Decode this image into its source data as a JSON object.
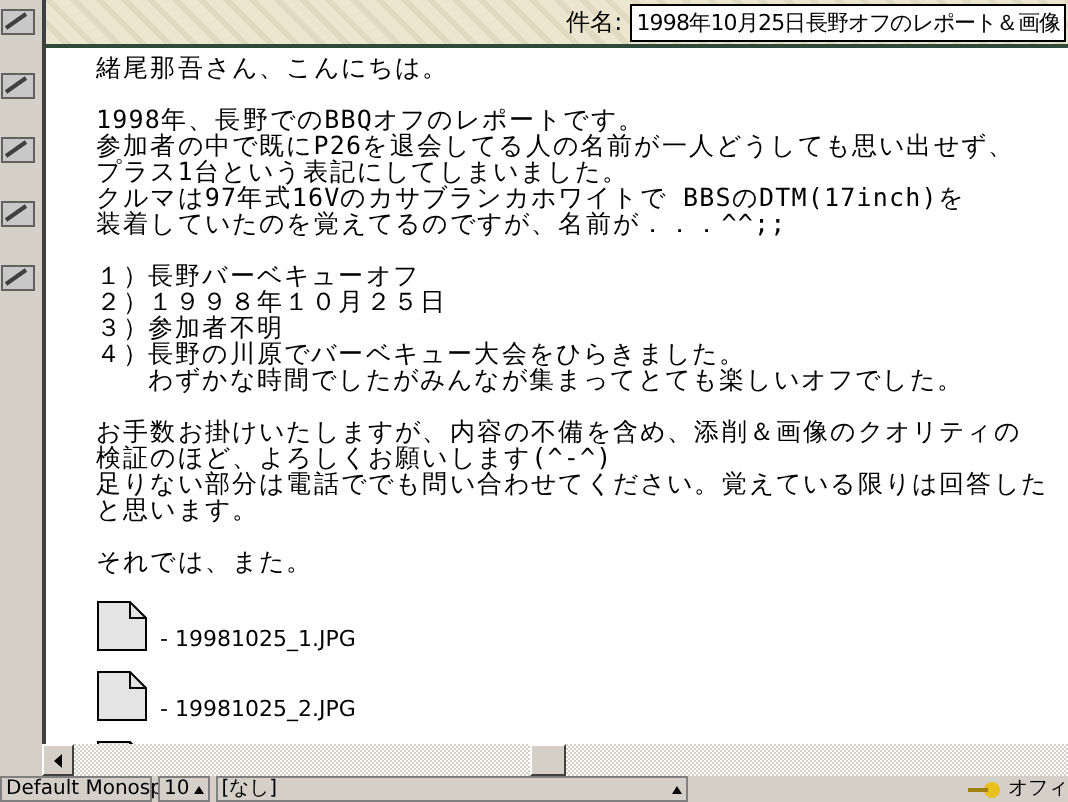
{
  "header": {
    "subject_label": "件名:",
    "subject": "1998年10月25日長野オフのレポート＆画像"
  },
  "body": {
    "paragraphs": [
      {
        "kind": "text",
        "lines": [
          "緒尾那吾さん、こんにちは。"
        ]
      },
      {
        "kind": "text",
        "lines": [
          "1998年、長野でのBBQオフのレポートです。",
          "参加者の中で既にP26を退会してる人の名前が一人どうしても思い出せず、",
          "プラス1台という表記にしてしまいました。",
          "クルマは97年式16Vのカサブランカホワイトで BBSのDTM(17inch)を",
          "装着していたのを覚えてるのですが、名前が．．．^^;;"
        ]
      },
      {
        "kind": "list",
        "items": [
          {
            "marker": "１）",
            "lines": [
              "長野バーベキューオフ"
            ]
          },
          {
            "marker": "２）",
            "lines": [
              "１９９８年１０月２５日"
            ]
          },
          {
            "marker": "３）",
            "lines": [
              "参加者不明"
            ]
          },
          {
            "marker": "４）",
            "lines": [
              "長野の川原でバーベキュー大会をひらきました。",
              "わずかな時間でしたがみんなが集まってとても楽しいオフでした。"
            ]
          }
        ]
      },
      {
        "kind": "text",
        "lines": [
          "お手数お掛けいたしますが、内容の不備を含め、添削＆画像のクオリティの",
          "検証のほど、よろしくお願いします(^-^)",
          "足りない部分は電話ででも問い合わせてください。覚えている限りは回答した",
          "と思います。"
        ]
      },
      {
        "kind": "text",
        "lines": [
          "それでは、また。"
        ]
      }
    ]
  },
  "attachments": [
    {
      "kind": "labeled",
      "name": "- 19981025_1.JPG"
    },
    {
      "kind": "labeled",
      "name": "- 19981025_2.JPG"
    },
    {
      "kind": "cut"
    }
  ],
  "status_bar": {
    "font": "Default Monosp",
    "size": "10",
    "style": "[なし]",
    "right_label": "オフィ"
  }
}
